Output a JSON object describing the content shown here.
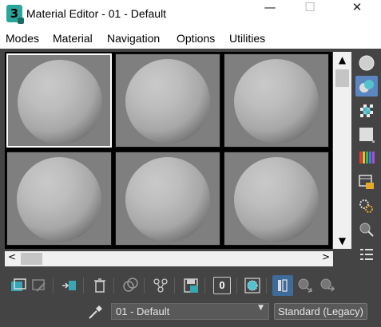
{
  "window": {
    "app_icon_glyph": "3",
    "title": "Material Editor - 01 - Default",
    "minimize_glyph": "—",
    "maximize_glyph": "☐",
    "close_glyph": "✕"
  },
  "menu": {
    "items": [
      {
        "label": "Modes"
      },
      {
        "label": "Material"
      },
      {
        "label": "Navigation"
      },
      {
        "label": "Options"
      },
      {
        "label": "Utilities"
      }
    ]
  },
  "sample_slots": {
    "count": 6,
    "active_index": 0
  },
  "scrollbars": {
    "up": "▲",
    "down": "▼",
    "left": "<",
    "right": ">"
  },
  "side_toolbar": [
    {
      "icon": "sample-type-sphere-icon"
    },
    {
      "icon": "backlight-icon"
    },
    {
      "icon": "background-checker-icon"
    },
    {
      "icon": "sample-uv-tiling-icon"
    },
    {
      "icon": "video-color-check-icon"
    },
    {
      "icon": "make-preview-icon"
    },
    {
      "icon": "material-editor-options-icon"
    },
    {
      "icon": "select-by-material-icon"
    },
    {
      "icon": "material-map-navigator-icon"
    }
  ],
  "bottom_toolbar": [
    {
      "icon": "get-material-icon"
    },
    {
      "icon": "put-to-scene-icon"
    },
    {
      "icon": "assign-to-selection-icon"
    },
    {
      "icon": "reset-map-icon"
    },
    {
      "icon": "copy-material-icon"
    },
    {
      "icon": "make-unique-icon"
    },
    {
      "icon": "put-to-library-icon"
    },
    {
      "icon": "material-id-channel-icon",
      "value": "0"
    },
    {
      "icon": "show-shaded-material-icon"
    },
    {
      "icon": "show-end-result-icon"
    },
    {
      "icon": "go-to-parent-icon"
    },
    {
      "icon": "go-forward-sibling-icon"
    }
  ],
  "material": {
    "name": "01 - Default",
    "type": "Standard (Legacy)"
  },
  "colors": {
    "panel_bg": "#444444",
    "selected_blue": "#5b86c0",
    "accent_teal": "#2aa59b"
  }
}
